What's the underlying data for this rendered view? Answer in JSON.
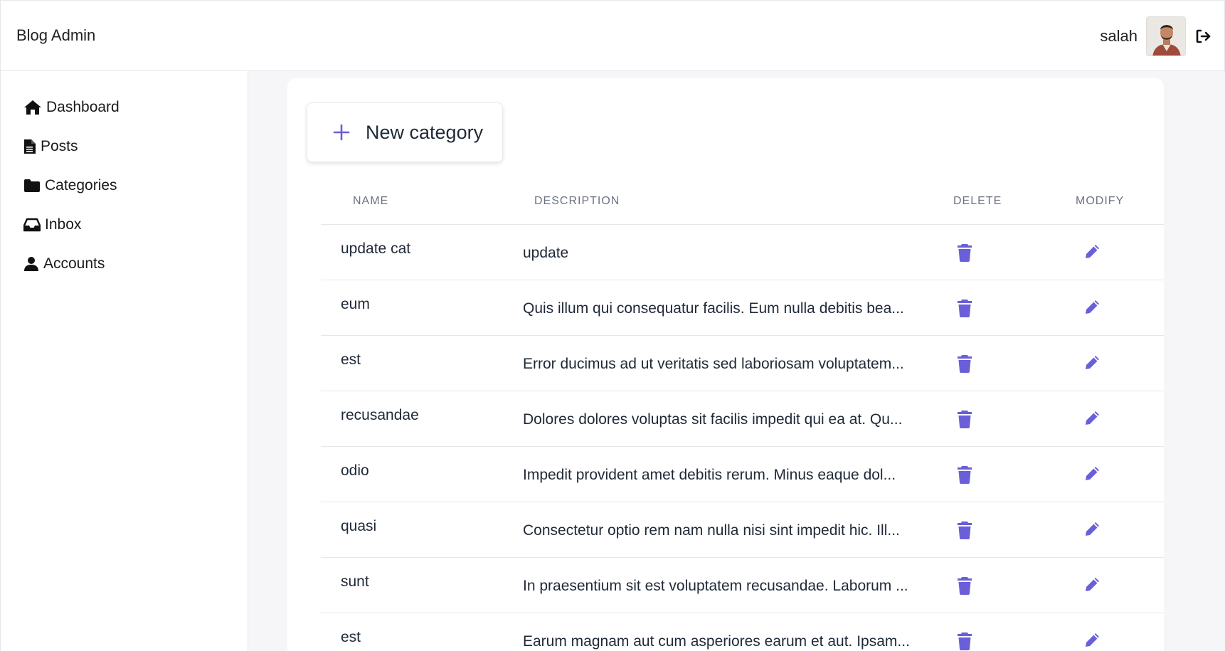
{
  "header": {
    "brand": "Blog Admin",
    "username": "salah",
    "avatar_icon": "user-avatar-photo",
    "logout_icon": "sign-out-icon"
  },
  "sidebar": {
    "items": [
      {
        "label": "Dashboard",
        "icon": "home-icon"
      },
      {
        "label": "Posts",
        "icon": "file-icon"
      },
      {
        "label": "Categories",
        "icon": "folder-icon"
      },
      {
        "label": "Inbox",
        "icon": "inbox-icon"
      },
      {
        "label": "Accounts",
        "icon": "user-icon"
      }
    ]
  },
  "main": {
    "new_button_label": "New category",
    "columns": [
      "NAME",
      "DESCRIPTION",
      "DELETE",
      "MODIFY"
    ],
    "rows": [
      {
        "name": "update cat",
        "description": "update"
      },
      {
        "name": "eum",
        "description": "Quis illum qui consequatur facilis. Eum nulla debitis bea..."
      },
      {
        "name": "est",
        "description": "Error ducimus ad ut veritatis sed laboriosam voluptatem..."
      },
      {
        "name": "recusandae",
        "description": "Dolores dolores voluptas sit facilis impedit qui ea at. Qu..."
      },
      {
        "name": "odio",
        "description": "Impedit provident amet debitis rerum. Minus eaque dol..."
      },
      {
        "name": "quasi",
        "description": "Consectetur optio rem nam nulla nisi sint impedit hic. Ill..."
      },
      {
        "name": "sunt",
        "description": "In praesentium sit est voluptatem recusandae. Laborum ..."
      },
      {
        "name": "est",
        "description": "Earum magnam aut cum asperiores earum et aut. Ipsam..."
      }
    ]
  },
  "colors": {
    "accent": "#6a5fd8",
    "text": "#1f2937",
    "muted": "#6b7280",
    "border": "#e5e7eb",
    "page_bg": "#f6f6f8"
  }
}
